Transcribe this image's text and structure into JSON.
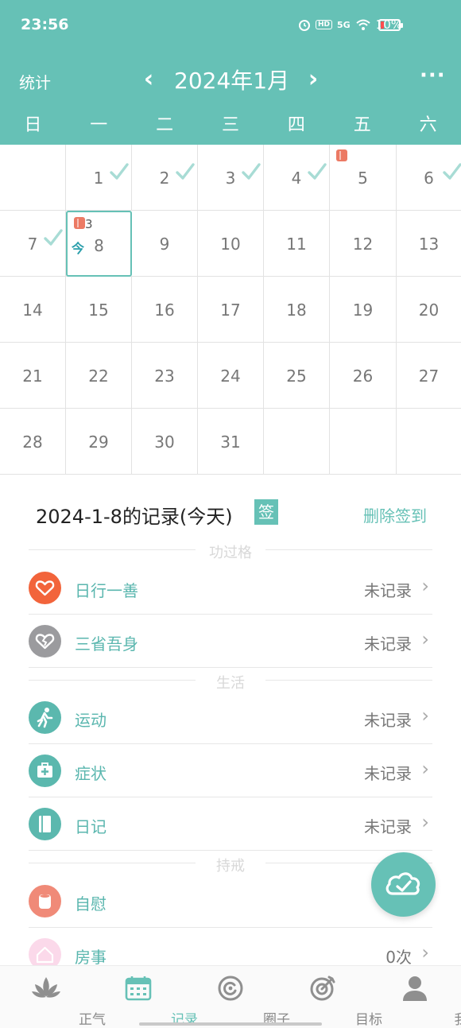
{
  "status_bar": {
    "time": "23:56",
    "hd": "HD",
    "network": "5G",
    "battery": "10%"
  },
  "nav": {
    "stats_label": "统计",
    "prev_icon": "‹",
    "month_title": "2024年1月",
    "next_icon": "›",
    "more_icon": "···"
  },
  "weekdays": [
    "日",
    "一",
    "二",
    "三",
    "四",
    "五",
    "六"
  ],
  "calendar": {
    "days": {
      "1": "1",
      "2": "2",
      "3": "3",
      "4": "4",
      "5": "5",
      "6": "6",
      "7": "7",
      "8": "8",
      "9": "9",
      "10": "10",
      "11": "11",
      "12": "12",
      "13": "13",
      "14": "14",
      "15": "15",
      "16": "16",
      "17": "17",
      "18": "18",
      "19": "19",
      "20": "20",
      "21": "21",
      "22": "22",
      "23": "23",
      "24": "24",
      "25": "25",
      "26": "26",
      "27": "27",
      "28": "28",
      "29": "29",
      "30": "30",
      "31": "31"
    },
    "checked_days": [
      1,
      2,
      3,
      4,
      6,
      7
    ],
    "marked_days": [
      5,
      8
    ],
    "today_mark": "今",
    "today_count": "3"
  },
  "records": {
    "title": "2024-1-8的记录(今天)",
    "sign_badge": "签",
    "delete_label": "删除签到",
    "section_merit": "功过格",
    "section_life": "生活",
    "section_precept": "持戒",
    "items": [
      {
        "label": "日行一善",
        "status": "未记录",
        "icon": "heart-icon",
        "color": "#f2643b"
      },
      {
        "label": "三省吾身",
        "status": "未记录",
        "icon": "broken-heart-icon",
        "color": "#9b9b9e"
      },
      {
        "label": "运动",
        "status": "未记录",
        "icon": "running-icon",
        "color": "#5bb8ae"
      },
      {
        "label": "症状",
        "status": "未记录",
        "icon": "medical-kit-icon",
        "color": "#5bb8ae"
      },
      {
        "label": "日记",
        "status": "未记录",
        "icon": "diary-icon",
        "color": "#5bb8ae"
      },
      {
        "label": "自慰",
        "status": "",
        "icon": "tissue-roll-icon",
        "color": "#f08a78"
      },
      {
        "label": "房事",
        "status": "0次",
        "icon": "house-icon",
        "color": "#fbd9ea"
      }
    ]
  },
  "tabs": [
    {
      "label": "正气",
      "icon": "lotus-icon"
    },
    {
      "label": "记录",
      "icon": "calendar-icon"
    },
    {
      "label": "圈子",
      "icon": "circle-icon"
    },
    {
      "label": "目标",
      "icon": "target-icon"
    },
    {
      "label": "我",
      "icon": "user-icon"
    }
  ],
  "colors": {
    "accent": "#66c1b6",
    "active_tab": "#66c1b6"
  }
}
